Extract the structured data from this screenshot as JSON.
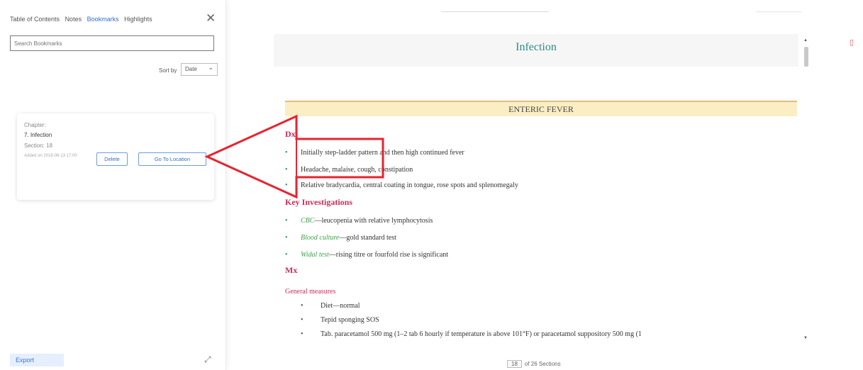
{
  "sidebar": {
    "tabs": [
      {
        "label": "Table of Contents",
        "active": false
      },
      {
        "label": "Notes",
        "active": false
      },
      {
        "label": "Bookmarks",
        "active": true
      },
      {
        "label": "Highlights",
        "active": false
      }
    ],
    "close_icon": "close-icon",
    "search_placeholder": "Search Bookmarks",
    "sort_label": "Sort by",
    "sort_value": "Date",
    "bookmark": {
      "chapter_label": "Chapter:",
      "chapter_value": "7. Infection",
      "section_label": "Section: 18",
      "added": "Added on 2018-06-13 17:00",
      "delete_label": "Delete",
      "goto_label": "Go To Location"
    },
    "export_label": "Export",
    "pin_icon": "pin-icon"
  },
  "reader": {
    "top_title": "———————————————————",
    "top_right": "————————",
    "chapter_title": "Infection",
    "section_title": "ENTERIC FEVER",
    "dx_heading": "Dx",
    "dx_items": [
      "Initially step-ladder pattern and then high continued fever",
      "Headache, malaise, cough, constipation",
      "Relative bradycardia, central coating in tongue, rose spots and splenomegaly"
    ],
    "inv_heading": "Key Investigations",
    "inv_items": [
      {
        "term": "CBC",
        "rest": "—leucopenia with relative lymphocytosis"
      },
      {
        "term": "Blood culture",
        "rest": "—gold standard test"
      },
      {
        "term": "Widal test",
        "rest": "—rising titre or fourfold rise is significant"
      }
    ],
    "mx_heading": "Mx",
    "general_heading": "General measures",
    "general_items": [
      "Diet—normal",
      "Tepid sponging SOS",
      "Tab. paracetamol 500 mg (1–2 tab 6 hourly if temperature is above 101°F) or paracetamol suppository 500 mg (1"
    ],
    "pager_page": "18",
    "pager_total": "of 26 Sections"
  },
  "colors": {
    "accent": "#2f6fc9",
    "chapter_title": "#2e8d83",
    "heading": "#c92b5b",
    "annotation": "#e8232f",
    "section_band": "#fbeec4"
  }
}
